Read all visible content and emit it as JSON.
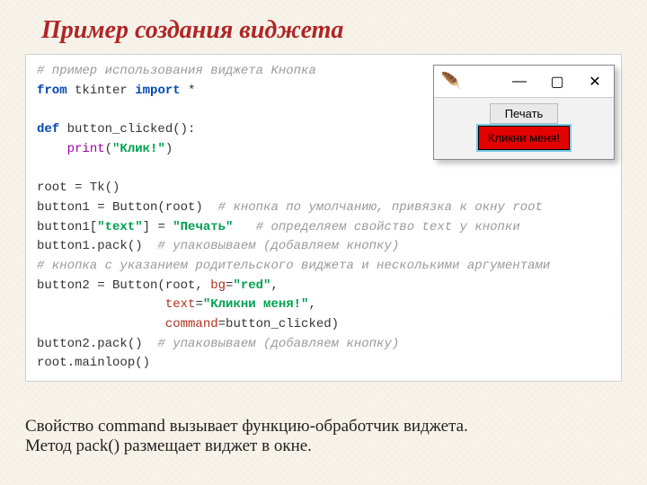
{
  "title": "Пример создания виджета",
  "code": {
    "l1_comment": "# пример использования виджета Кнопка",
    "l2_from": "from",
    "l2_module": " tkinter ",
    "l2_import": "import",
    "l2_star": " *",
    "l4_def": "def",
    "l4_name": " button_clicked():",
    "l5_indent": "    ",
    "l5_print": "print",
    "l5_open": "(",
    "l5_str": "\"Клик!\"",
    "l5_close": ")",
    "l7": "root = Tk()",
    "l8a": "button1 = Button(root)  ",
    "l8c": "# кнопка по умолчанию, привязка к окну root",
    "l9a": "button1[",
    "l9key": "\"text\"",
    "l9b": "] = ",
    "l9val": "\"Печать\"",
    "l9sp": "   ",
    "l9c": "# определяем свойство text у кнопки",
    "l10a": "button1.pack()  ",
    "l10c": "# упаковываем (добавляем кнопку)",
    "l11c": "# кнопка с указанием родительского виджета и несколькими аргументами",
    "l12a": "button2 = Button(root, ",
    "l12bg": "bg",
    "l12eq": "=",
    "l12bgv": "\"red\"",
    "l12end": ",",
    "l13pad": "                 ",
    "l13txt": "text",
    "l13eq": "=",
    "l13val": "\"Кликни меня!\"",
    "l13end": ",",
    "l14pad": "                 ",
    "l14cmd": "command",
    "l14eq": "=button_clicked)",
    "l15a": "button2.pack()  ",
    "l15c": "# упаковываем (добавляем кнопку)",
    "l16": "root.mainloop()"
  },
  "window": {
    "feather_icon": "🪶",
    "min": "—",
    "max": "▢",
    "close": "✕",
    "button1": "Печать",
    "button2": "Кликни меня!"
  },
  "footer1": "Свойство command вызывает функцию-обработчик виджета.",
  "footer2": "Метод pack() размещает виджет в окне."
}
